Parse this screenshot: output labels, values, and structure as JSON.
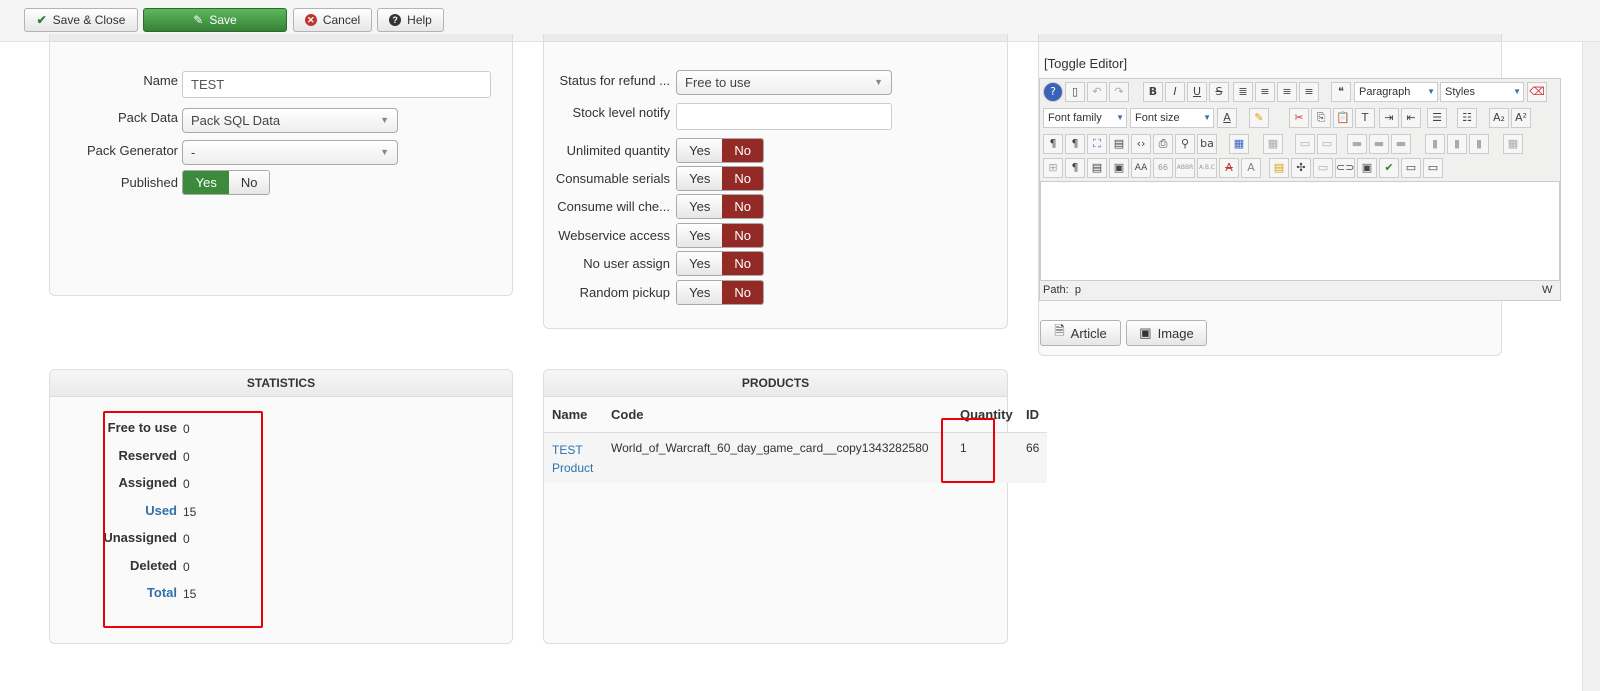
{
  "toolbar": {
    "save_close": "Save & Close",
    "save": "Save",
    "cancel": "Cancel",
    "help": "Help"
  },
  "general": {
    "name_label": "Name",
    "name_value": "TEST",
    "pack_data_label": "Pack Data",
    "pack_data_value": "Pack SQL Data",
    "pack_generator_label": "Pack Generator",
    "pack_generator_value": "-",
    "published_label": "Published",
    "published_yes": "Yes",
    "published_no": "No"
  },
  "settings": {
    "status_refund_label": "Status for refund ...",
    "status_refund_value": "Free to use",
    "stock_notify_label": "Stock level notify",
    "stock_notify_value": "",
    "yes": "Yes",
    "no": "No",
    "toggles": [
      {
        "label": "Unlimited quantity"
      },
      {
        "label": "Consumable serials"
      },
      {
        "label": "Consume will che..."
      },
      {
        "label": "Webservice access"
      },
      {
        "label": "No user assign"
      },
      {
        "label": "Random pickup"
      }
    ]
  },
  "editor": {
    "toggle_label": "[Toggle Editor]",
    "paragraph": "Paragraph",
    "styles": "Styles",
    "font_family": "Font family",
    "font_size": "Font size",
    "path_label": "Path:",
    "path_value": "p",
    "word_count": "W",
    "article_button": "Article",
    "image_button": "Image"
  },
  "statistics": {
    "title": "STATISTICS",
    "rows": [
      {
        "label": "Free to use",
        "value": "0",
        "link": false
      },
      {
        "label": "Reserved",
        "value": "0",
        "link": false
      },
      {
        "label": "Assigned",
        "value": "0",
        "link": false
      },
      {
        "label": "Used",
        "value": "15",
        "link": true
      },
      {
        "label": "Unassigned",
        "value": "0",
        "link": false
      },
      {
        "label": "Deleted",
        "value": "0",
        "link": false
      },
      {
        "label": "Total",
        "value": "15",
        "link": true
      }
    ]
  },
  "products": {
    "title": "PRODUCTS",
    "columns": [
      "Name",
      "Code",
      "Quantity",
      "ID"
    ],
    "rows": [
      {
        "name_line1": "TEST",
        "name_line2": "Product",
        "code": "World_of_Warcraft_60_day_game_card__copy1343282580",
        "quantity": "1",
        "id": "66"
      }
    ]
  }
}
